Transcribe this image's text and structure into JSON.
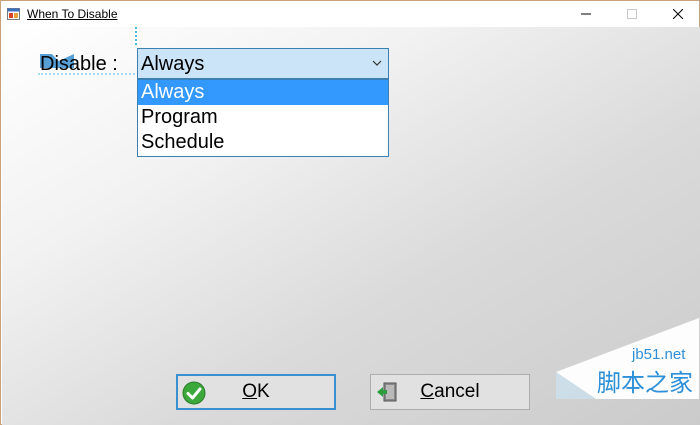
{
  "window": {
    "title": "When To Disable",
    "controls": {
      "minimize": "—",
      "maximize": "☐",
      "close": "✕"
    }
  },
  "form": {
    "disable_label": "Disable :",
    "combo": {
      "value": "Always",
      "options": [
        "Always",
        "Program",
        "Schedule"
      ],
      "selected_index": 0
    }
  },
  "buttons": {
    "ok": {
      "label": "OK",
      "mnemonic": "O",
      "rest": "K",
      "icon": "check-icon"
    },
    "cancel": {
      "label": "Cancel",
      "mnemonic": "C",
      "rest": "ancel",
      "icon": "exit-door-icon"
    }
  },
  "watermark": {
    "line1": "jb51.net",
    "line2": "脚本之家"
  },
  "colors": {
    "selection": "#3399ff",
    "combo_bg": "#cce4f7",
    "focus_border": "#3a8fd0",
    "watermark": "#2c8fd8"
  }
}
